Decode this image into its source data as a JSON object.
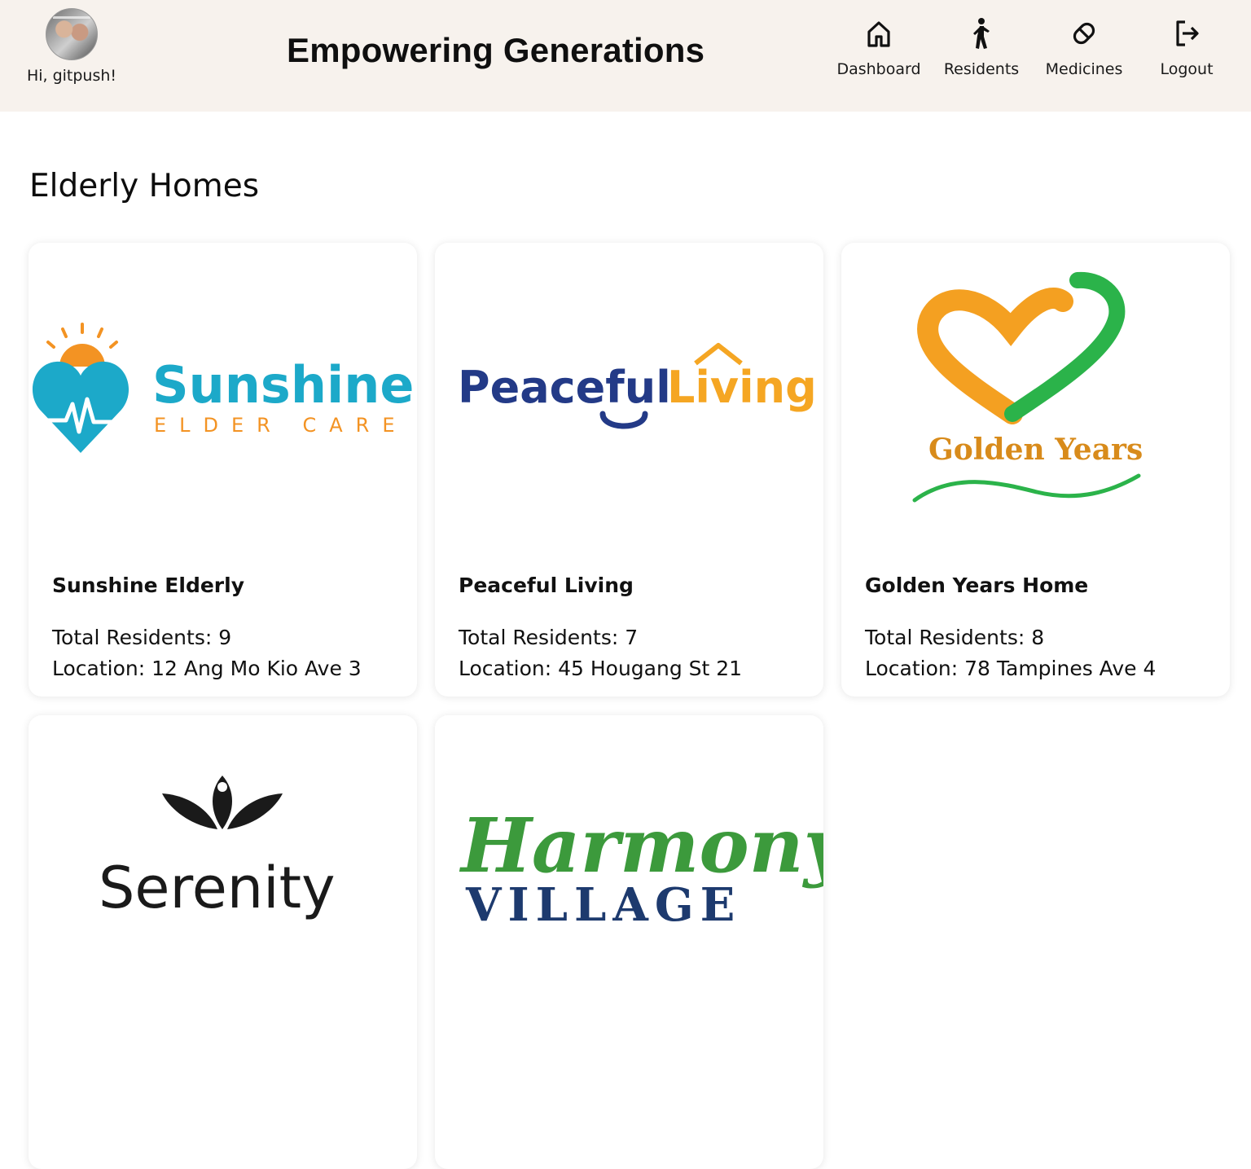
{
  "header": {
    "greeting": "Hi, gitpush!",
    "app_title": "Empowering Generations",
    "nav": [
      {
        "label": "Dashboard",
        "icon": "home-icon"
      },
      {
        "label": "Residents",
        "icon": "person-walking-icon"
      },
      {
        "label": "Medicines",
        "icon": "pill-icon"
      },
      {
        "label": "Logout",
        "icon": "logout-icon"
      }
    ]
  },
  "main": {
    "title": "Elderly Homes",
    "homes": [
      {
        "name": "Sunshine Elderly",
        "residents_text": "Total Residents: 9",
        "location_text": "Location: 12 Ang Mo Kio Ave 3",
        "logo": {
          "text": "Sunshine",
          "subtext": "ELDER CARE",
          "colors": [
            "#1ca9c9",
            "#f39323"
          ]
        }
      },
      {
        "name": "Peaceful Living",
        "residents_text": "Total Residents: 7",
        "location_text": "Location: 45 Hougang St 21",
        "logo": {
          "text": "Peaceful",
          "text2": "Living",
          "colors": [
            "#233a87",
            "#f5a623"
          ]
        }
      },
      {
        "name": "Golden Years Home",
        "residents_text": "Total Residents: 8",
        "location_text": "Location: 78 Tampines Ave 4",
        "logo": {
          "text": "Golden Years",
          "colors": [
            "#f4a021",
            "#2bb34a",
            "#d88b1b"
          ]
        }
      },
      {
        "name": "",
        "residents_text": "",
        "location_text": "",
        "logo": {
          "text": "Serenity",
          "colors": [
            "#1a1a1a"
          ]
        }
      },
      {
        "name": "",
        "residents_text": "",
        "location_text": "",
        "logo": {
          "text": "Harmony",
          "subtext": "VILLAGE",
          "colors": [
            "#3c9a3c",
            "#1d3a6e"
          ]
        }
      }
    ]
  }
}
